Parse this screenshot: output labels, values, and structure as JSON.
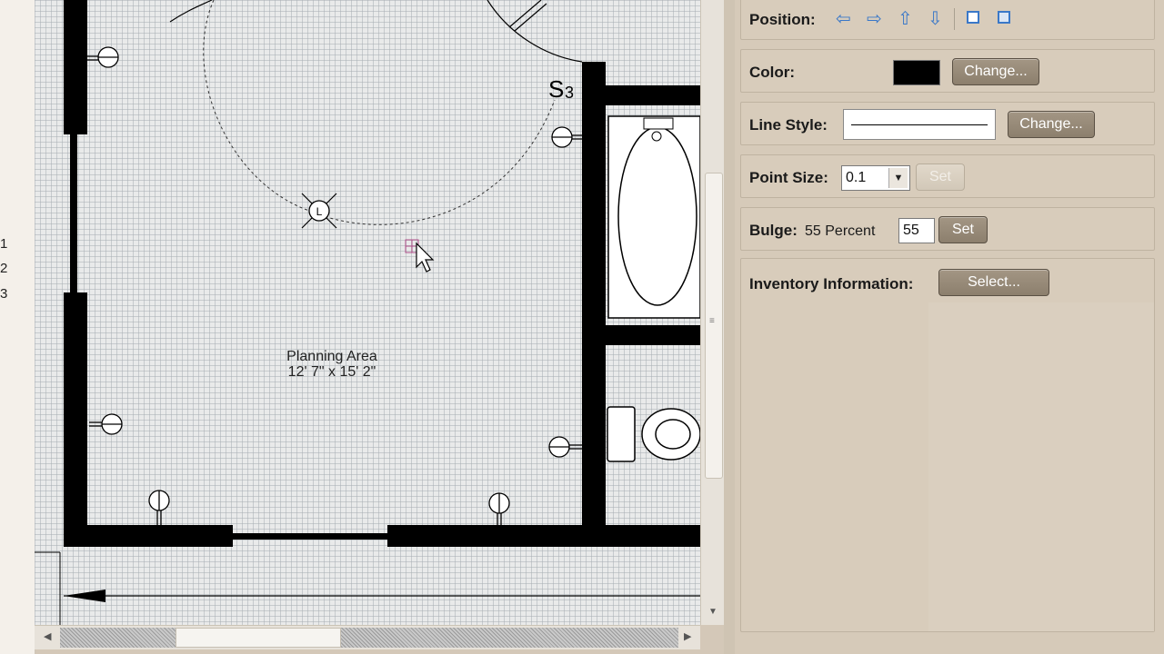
{
  "row_numbers": [
    "1",
    "2",
    "3"
  ],
  "plan": {
    "area_title": "Planning Area",
    "area_dims": "12' 7\" x 15' 2\"",
    "switch_label": "S",
    "switch_sub": "3",
    "light_label": "L"
  },
  "properties": {
    "position_label": "Position:",
    "position_icons": [
      "arrow-left-icon",
      "arrow-right-icon",
      "arrow-up-icon",
      "arrow-down-icon",
      "bring-front-icon",
      "send-back-icon"
    ],
    "color_label": "Color:",
    "color_value": "#000000",
    "color_button": "Change...",
    "line_style_label": "Line Style:",
    "line_style_button": "Change...",
    "point_size_label": "Point Size:",
    "point_size_value": "0.1",
    "point_size_button": "Set",
    "bulge_label": "Bulge:",
    "bulge_text": "55 Percent",
    "bulge_value": "55",
    "bulge_button": "Set",
    "inventory_label": "Inventory Information:",
    "inventory_button": "Select..."
  }
}
